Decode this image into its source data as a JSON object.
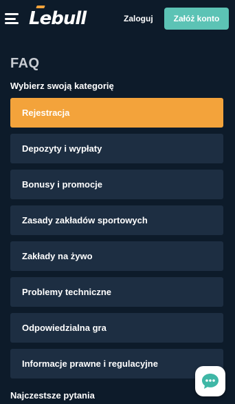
{
  "header": {
    "logo_text": "Lebull",
    "login_label": "Zaloguj",
    "register_label": "Załóż konto",
    "icons": {
      "menu": "hamburger-menu-icon"
    }
  },
  "main": {
    "title": "FAQ",
    "category_heading": "Wybierz swoją kategorię",
    "categories": [
      {
        "label": "Rejestracja",
        "active": true
      },
      {
        "label": "Depozyty i wypłaty",
        "active": false
      },
      {
        "label": "Bonusy i promocje",
        "active": false
      },
      {
        "label": "Zasady zakładów sportowych",
        "active": false
      },
      {
        "label": "Zakłady na żywo",
        "active": false
      },
      {
        "label": "Problemy techniczne",
        "active": false
      },
      {
        "label": "Odpowiedzialna gra",
        "active": false
      },
      {
        "label": "Informacje prawne i regulacyjne",
        "active": false
      }
    ],
    "popular_heading": "Najczestsze pytania"
  },
  "chat": {
    "icon": "chat-bubble-icon"
  },
  "colors": {
    "background": "#0d1b2a",
    "card": "#1d2e42",
    "accent_orange": "#f3a33b",
    "accent_teal": "#5cc3b5",
    "title_gray": "#c8ccd2"
  }
}
